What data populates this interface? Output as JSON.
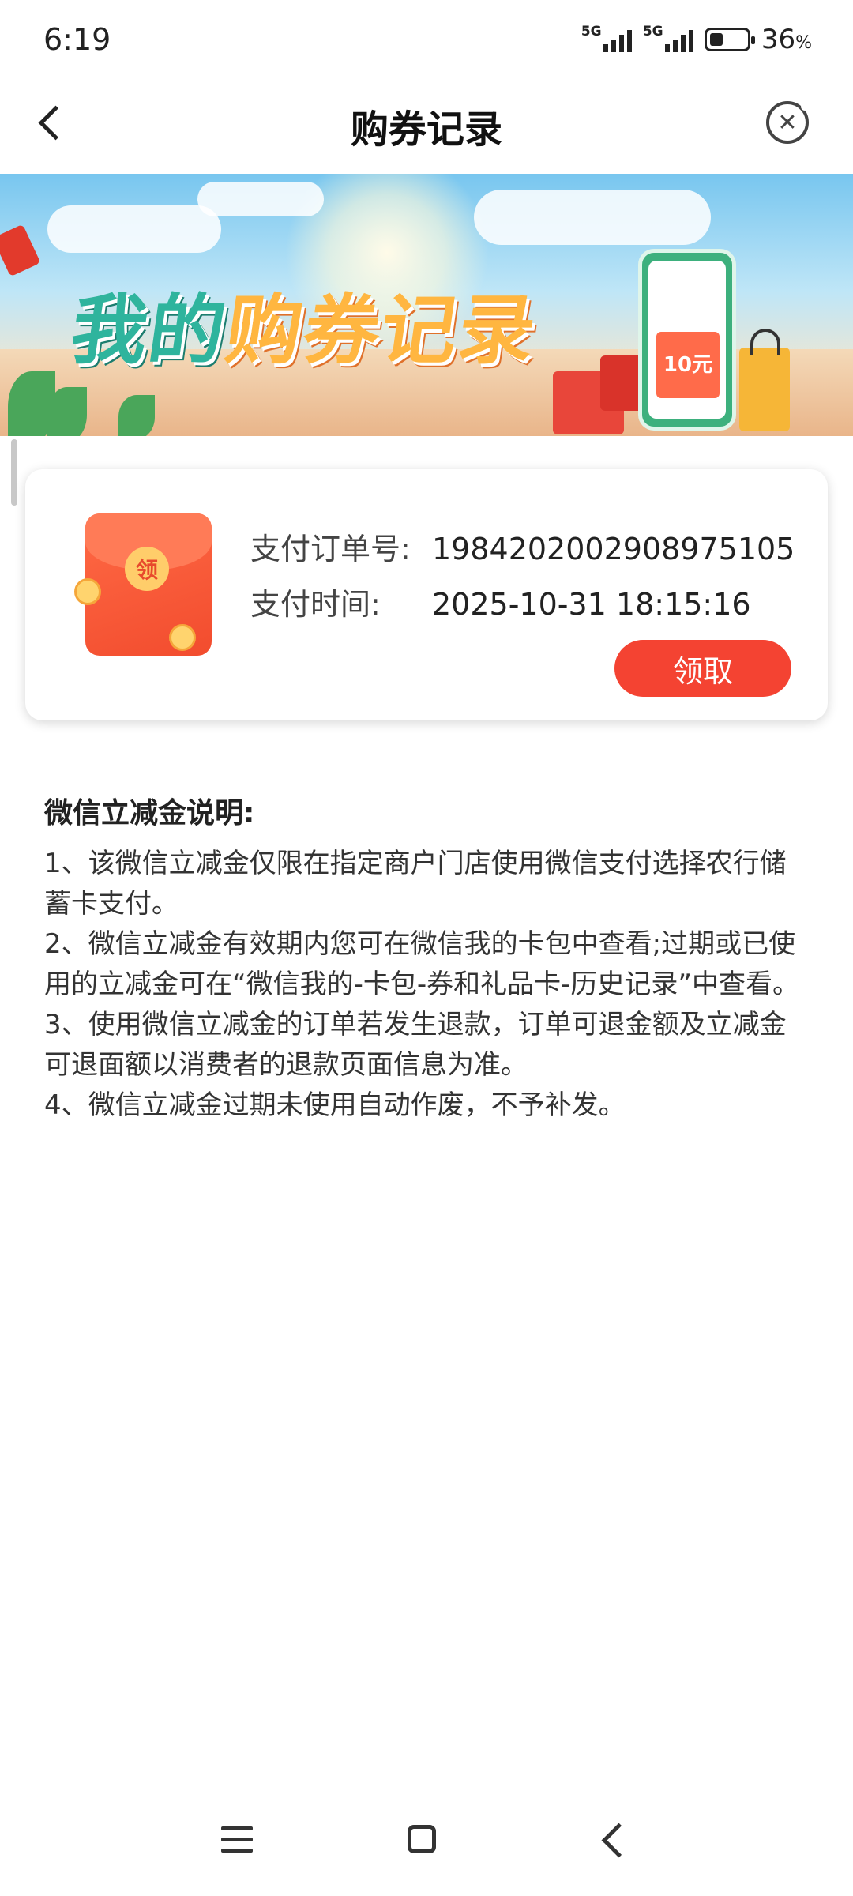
{
  "status_bar": {
    "time": "6:19",
    "signal_1_label": "5G",
    "signal_2_label": "5G",
    "battery_level": 36,
    "battery_text": "36",
    "battery_unit": "%"
  },
  "nav": {
    "title": "购券记录",
    "back_icon": "chevron-left-icon",
    "close_icon": "close-circle-icon"
  },
  "banner": {
    "title_part1": "我的",
    "title_part2": "购券记录",
    "coupon_value": "10元"
  },
  "record": {
    "order_label": "支付订单号:",
    "order_value": "1984202002908975105",
    "time_label": "支付时间:",
    "time_value": "2025-10-31 18:15:16",
    "claim_button": "领取",
    "envelope_seal": "领"
  },
  "notes": {
    "title": "微信立减金说明:",
    "items": [
      "1、该微信立减金仅限在指定商户门店使用微信支付选择农行储蓄卡支付。",
      "2、微信立减金有效期内您可在微信我的卡包中查看;过期或已使用的立减金可在“微信我的-卡包-券和礼品卡-历史记录”中查看。",
      "3、使用微信立减金的订单若发生退款，订单可退金额及立减金可退面额以消费者的退款页面信息为准。",
      "4、微信立减金过期未使用自动作废，不予补发。"
    ]
  },
  "colors": {
    "accent": "#f44332",
    "title_green": "#2fb49d",
    "title_orange": "#ffb640"
  }
}
